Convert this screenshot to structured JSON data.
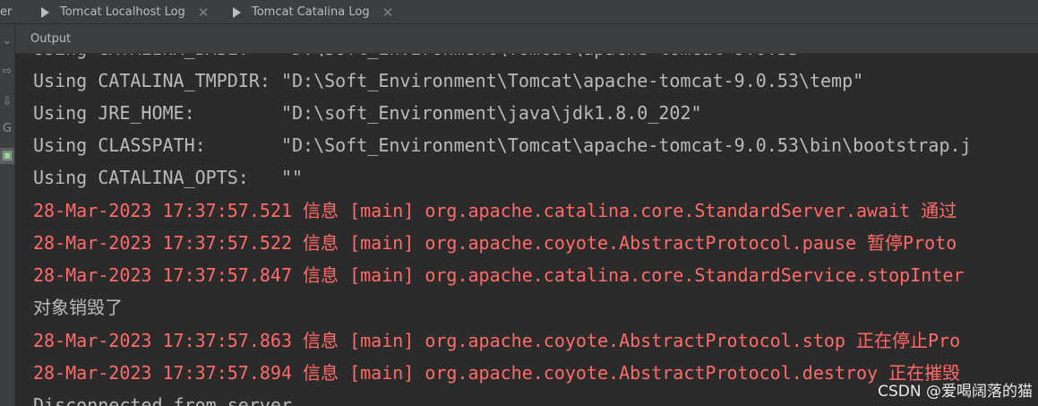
{
  "tabs": [
    {
      "label": "er",
      "closable": false
    },
    {
      "label": "Tomcat Localhost Log",
      "icon": "play-log-icon",
      "closable": true
    },
    {
      "label": "Tomcat Catalina Log",
      "icon": "play-log-icon",
      "closable": true
    }
  ],
  "close_glyph": "✕",
  "sidebar": {
    "buttons": [
      "chevron-down-icon",
      "import-icon",
      "import-icon",
      "rerun-icon",
      "active-run-icon"
    ]
  },
  "output_panel": {
    "label": "Output"
  },
  "console": {
    "lines": [
      {
        "text": "Using CATALINA_TMPDIR: \"D:\\Soft_Environment\\Tomcat\\apache-tomcat-9.0.53\\temp\"",
        "type": "normal"
      },
      {
        "text": "Using JRE_HOME:        \"D:\\soft_Environment\\java\\jdk1.8.0_202\"",
        "type": "normal"
      },
      {
        "text": "Using CLASSPATH:       \"D:\\Soft_Environment\\Tomcat\\apache-tomcat-9.0.53\\bin\\bootstrap.j",
        "type": "normal"
      },
      {
        "text": "Using CATALINA_OPTS:   \"\"",
        "type": "normal"
      },
      {
        "text": "28-Mar-2023 17:37:57.521 信息 [main] org.apache.catalina.core.StandardServer.await 通过",
        "type": "error"
      },
      {
        "text": "28-Mar-2023 17:37:57.522 信息 [main] org.apache.coyote.AbstractProtocol.pause 暂停Proto",
        "type": "error"
      },
      {
        "text": "28-Mar-2023 17:37:57.847 信息 [main] org.apache.catalina.core.StandardService.stopInter",
        "type": "error"
      },
      {
        "text": "对象销毁了",
        "type": "normal"
      },
      {
        "text": "28-Mar-2023 17:37:57.863 信息 [main] org.apache.coyote.AbstractProtocol.stop 正在停止Pro",
        "type": "error"
      },
      {
        "text": "28-Mar-2023 17:37:57.894 信息 [main] org.apache.coyote.AbstractProtocol.destroy 正在摧毁",
        "type": "error"
      },
      {
        "text": "Disconnected from server",
        "type": "normal"
      }
    ]
  },
  "watermark": "CSDN @爱喝阔落的猫",
  "colors": {
    "background": "#2b2b2b",
    "panel": "#3c3f41",
    "text": "#bbbbbb",
    "error": "#ff6b68"
  }
}
